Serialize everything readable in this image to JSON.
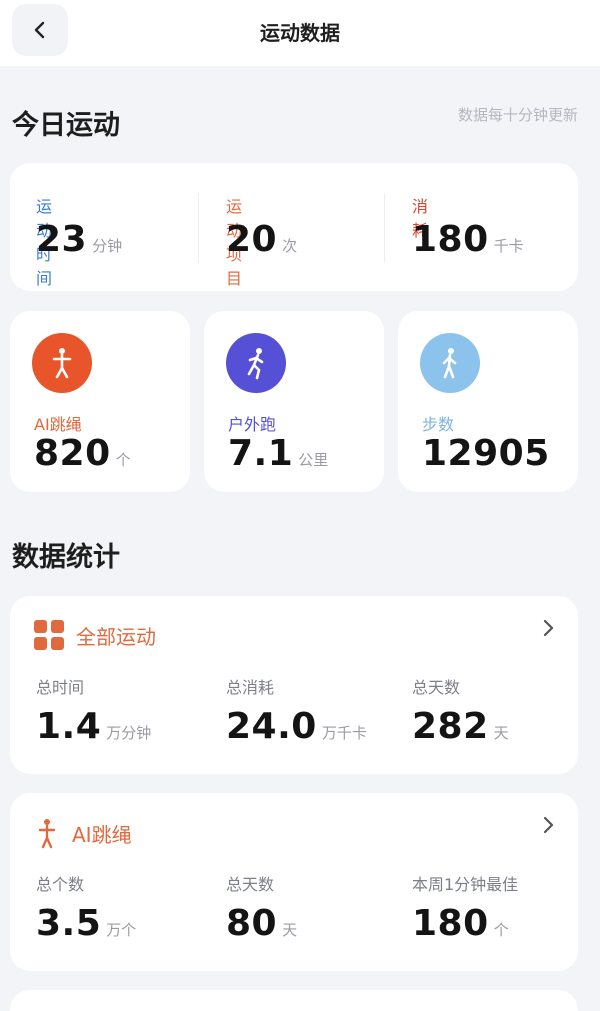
{
  "header": {
    "title": "运动数据",
    "back_icon": "chevron-left-icon"
  },
  "today": {
    "title": "今日运动",
    "update_note": "数据每十分钟更新",
    "summary": [
      {
        "label": "运动时间",
        "value": "23",
        "unit": "分钟",
        "color": "#3b7cd9"
      },
      {
        "label": "运动项目",
        "value": "20",
        "unit": "次",
        "color": "#e06a3e"
      },
      {
        "label": "消耗",
        "value": "180",
        "unit": "千卡",
        "color": "#e0452f"
      }
    ],
    "stats": [
      {
        "label": "AI跳绳",
        "value": "820",
        "unit": "个",
        "icon": "jump-rope-icon",
        "circle_color": "#e8552a",
        "label_color": "#e06a3e"
      },
      {
        "label": "户外跑",
        "value": "7.1",
        "unit": "公里",
        "icon": "running-icon",
        "circle_color": "#5650d6",
        "label_color": "#5650d6"
      },
      {
        "label": "步数",
        "value": "12905",
        "unit": "",
        "icon": "walking-icon",
        "circle_color": "#8cc3ec",
        "label_color": "#7fb3e0"
      }
    ]
  },
  "statistics": {
    "title": "数据统计",
    "all_sports": {
      "name": "全部运动",
      "icon": "grid-icon",
      "items": [
        {
          "label": "总时间",
          "value": "1.4",
          "unit": "万分钟"
        },
        {
          "label": "总消耗",
          "value": "24.0",
          "unit": "万千卡"
        },
        {
          "label": "总天数",
          "value": "282",
          "unit": "天"
        }
      ]
    },
    "jump_rope": {
      "name": "AI跳绳",
      "icon": "jump-rope-icon",
      "items": [
        {
          "label": "总个数",
          "value": "3.5",
          "unit": "万个"
        },
        {
          "label": "总天数",
          "value": "80",
          "unit": "天"
        },
        {
          "label": "本周1分钟最佳",
          "value": "180",
          "unit": "个"
        }
      ]
    }
  }
}
